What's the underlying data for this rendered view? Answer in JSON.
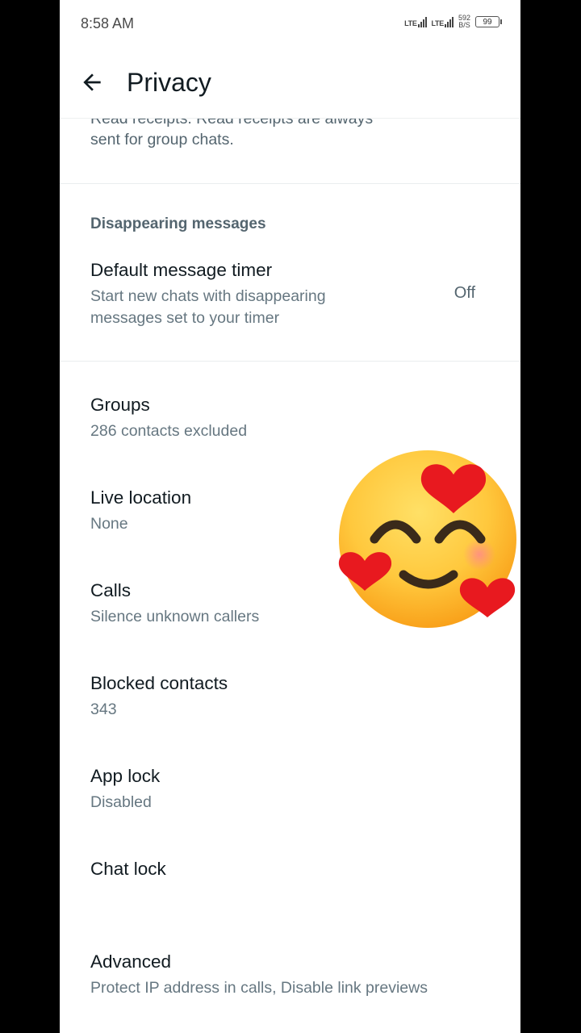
{
  "status_bar": {
    "time": "8:58 AM",
    "net1": "LTE",
    "net2": "LTE",
    "speed_value": "592",
    "speed_unit": "B/S",
    "battery": "99"
  },
  "header": {
    "title": "Privacy",
    "back_icon": "arrow-left-icon"
  },
  "read_receipts_tail": {
    "line1": "Read receipts. Read receipts are always",
    "line2": "sent for group chats."
  },
  "disappearing": {
    "section_title": "Disappearing messages",
    "timer_title": "Default message timer",
    "timer_sub1": "Start new chats with disappearing",
    "timer_sub2": "messages set to your timer",
    "timer_value": "Off"
  },
  "items": [
    {
      "title": "Groups",
      "subtitle": "286 contacts excluded"
    },
    {
      "title": "Live location",
      "subtitle": "None"
    },
    {
      "title": "Calls",
      "subtitle": "Silence unknown callers"
    },
    {
      "title": "Blocked contacts",
      "subtitle": "343"
    },
    {
      "title": "App lock",
      "subtitle": "Disabled"
    },
    {
      "title": "Chat lock",
      "subtitle": ""
    },
    {
      "title": "Advanced",
      "subtitle": "Protect IP address in calls, Disable link previews"
    }
  ],
  "overlay": {
    "icon": "smiling-face-with-hearts-icon"
  },
  "colors": {
    "background": "#ffffff",
    "primary_text": "#111b21",
    "secondary_text": "#667781",
    "section_text": "#54656f"
  }
}
